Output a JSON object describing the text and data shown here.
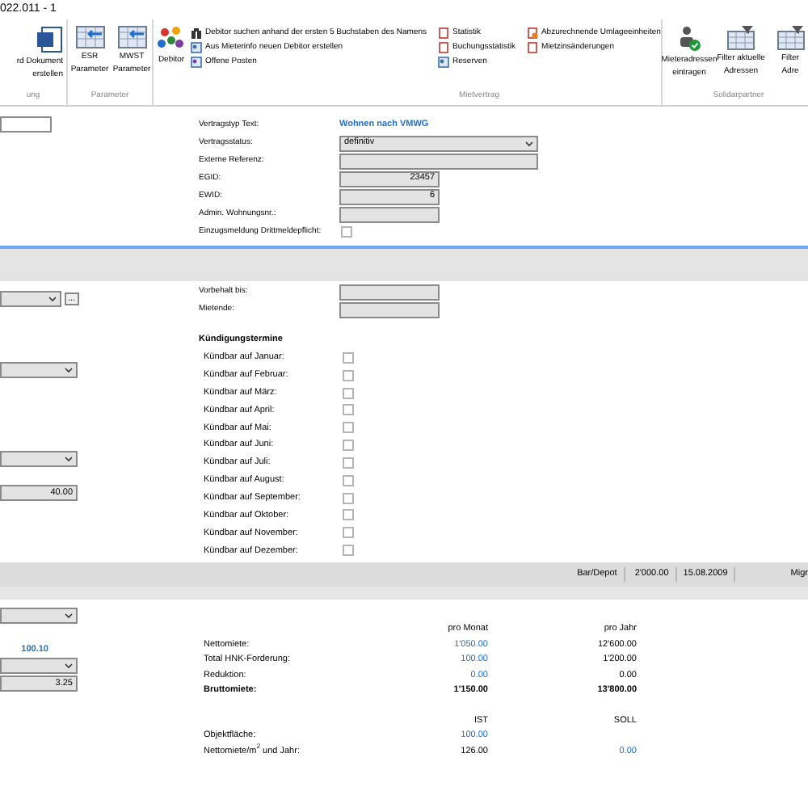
{
  "window": {
    "title": "022.011 - 1"
  },
  "ribbon": {
    "groups": [
      {
        "label": "ung",
        "large_buttons": [
          {
            "lines": [
              "rd Dokument",
              "erstellen"
            ]
          }
        ]
      },
      {
        "label": "Parameter",
        "large_buttons": [
          {
            "lines": [
              "ESR",
              "Parameter"
            ]
          },
          {
            "lines": [
              "MWST",
              "Parameter"
            ]
          }
        ]
      },
      {
        "label": "Mietvertrag",
        "large_buttons": [
          {
            "lines": [
              "Debitor"
            ]
          }
        ],
        "small_columns": [
          [
            "Debitor suchen anhand der ersten 5 Buchstaben des Namens",
            "Aus Mieterinfo neuen Debitor erstellen",
            "Offene Posten"
          ],
          [
            "Statistik",
            "Buchungsstatistik",
            "Reserven"
          ],
          [
            "Abzurechnende Umlageeinheiten",
            "Mietzinsänderungen"
          ]
        ]
      },
      {
        "label": "Solidarpartner",
        "large_buttons": [
          {
            "lines": [
              "Mieteradressen",
              "eintragen"
            ]
          },
          {
            "lines": [
              "Filter aktuelle",
              "Adressen"
            ]
          },
          {
            "lines": [
              "Filter",
              "Adre"
            ]
          }
        ]
      }
    ]
  },
  "contract": {
    "fields": [
      {
        "kind": "link",
        "label": "Vertragstyp Text:",
        "value": "Wohnen nach VMWG"
      },
      {
        "kind": "dropdown",
        "label": "Vertragsstatus:",
        "value": "definitiv"
      },
      {
        "kind": "wide_field",
        "label": "Externe Referenz:"
      },
      {
        "kind": "field",
        "label": "EGID:",
        "value": "23457"
      },
      {
        "kind": "field",
        "label": "EWID:",
        "value": "6"
      },
      {
        "kind": "field",
        "label": "Admin. Wohnungsnr.:"
      },
      {
        "kind": "checkbox",
        "label": "Einzugsmeldung Drittmeldepflicht:",
        "checked": false
      }
    ]
  },
  "terms": {
    "left_controls": [
      {
        "kind": "dropdown_with_button",
        "button": "..."
      },
      {
        "kind": "dropdown"
      },
      {
        "kind": "dropdown"
      },
      {
        "kind": "field",
        "value": "40.00"
      }
    ],
    "fields": [
      {
        "label": "Vorbehalt bis:"
      },
      {
        "label": "Mietende:"
      }
    ],
    "notice_title": "Kündigungstermine",
    "notice_months": [
      {
        "label": "Kündbar auf Januar:",
        "checked": false
      },
      {
        "label": "Kündbar auf Februar:",
        "checked": false
      },
      {
        "label": "Kündbar auf März:",
        "checked": false
      },
      {
        "label": "Kündbar auf April:",
        "checked": false
      },
      {
        "label": "Kündbar auf Mai:",
        "checked": false
      },
      {
        "label": "Kündbar auf Juni:",
        "checked": false
      },
      {
        "label": "Kündbar auf Juli:",
        "checked": false
      },
      {
        "label": "Kündbar auf August:",
        "checked": false
      },
      {
        "label": "Kündbar auf September:",
        "checked": false
      },
      {
        "label": "Kündbar auf Oktober:",
        "checked": false
      },
      {
        "label": "Kündbar auf November:",
        "checked": false
      },
      {
        "label": "Kündbar auf Dezember:",
        "checked": false
      }
    ]
  },
  "summary_bar": {
    "items": [
      "Bar/Depot",
      "2'000.00",
      "15.08.2009",
      "Migr"
    ]
  },
  "rent": {
    "left_controls": [
      {
        "kind": "dropdown"
      },
      {
        "kind": "link",
        "value": "100.10"
      },
      {
        "kind": "dropdown"
      },
      {
        "kind": "field",
        "value": "3.25"
      }
    ],
    "columns": [
      "pro Monat",
      "pro Jahr"
    ],
    "rows": [
      {
        "kind": "normal",
        "label": "Nettomiete:",
        "month": "1'050.00",
        "month_editable": true,
        "year": "12'600.00",
        "year_editable": false
      },
      {
        "kind": "normal",
        "label": "Total HNK-Forderung:",
        "month": "100.00",
        "month_editable": true,
        "year": "1'200.00",
        "year_editable": false
      },
      {
        "kind": "normal",
        "label": "Reduktion:",
        "month": "0.00",
        "month_editable": true,
        "year": "0.00",
        "year_editable": false
      },
      {
        "kind": "total",
        "label": "Bruttomiete:",
        "month": "1'150.00",
        "month_editable": false,
        "year": "13'800.00",
        "year_editable": false
      }
    ],
    "area_columns": [
      "IST",
      "SOLL"
    ],
    "area_rows": [
      {
        "label": "Objektfläche:",
        "month": "100.00",
        "month_editable": true,
        "year_editable": false
      },
      {
        "label": "Nettomiete/m$^{2}$ und Jahr:",
        "month": "126.00",
        "month_editable": false,
        "year": "0.00",
        "year_editable": true
      }
    ]
  }
}
